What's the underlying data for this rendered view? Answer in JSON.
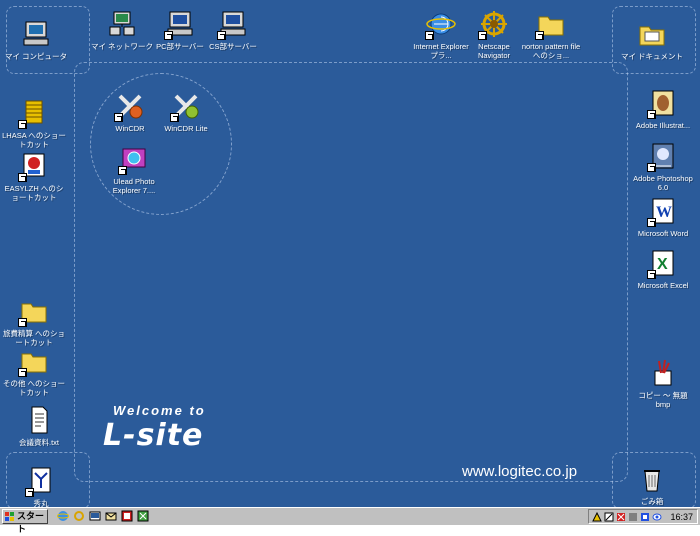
{
  "desktop": {
    "background": "#2b5b9a",
    "icons": {
      "my_computer": "マイ コンピュータ",
      "my_network": "マイ ネットワーク",
      "pc_server": "PC部サーバー",
      "cs_server": "CS部サーバー",
      "internet_explorer": "Internet Explorer プラ...",
      "netscape": "Netscape Navigator",
      "norton": "norton pattern file へのショ...",
      "my_documents": "マイ ドキュメント",
      "lhasa": "LHASA へのショートカット",
      "easylzh": "EASYLZH へのショートカット",
      "wincdr": "WinCDR",
      "wincdr_lite": "WinCDR Lite",
      "ulead": "Ulead Photo Explorer 7....",
      "travel_expense": "旅費精算 へのショートカット",
      "other": "その他 へのショートカット",
      "meeting_doc": "会議資料.txt",
      "hidemaru": "秀丸",
      "illustrator": "Adobe Illustrat...",
      "photoshop": "Adobe Photoshop 6.0",
      "word": "Microsoft Word",
      "excel": "Microsoft Excel",
      "copy_bmp": "コピー ～ 無題 bmp",
      "recycle_bin": "ごみ箱"
    },
    "wallpaper": {
      "welcome": "Welcome to",
      "brand": "L-site",
      "url": "www.logitec.co.jp"
    }
  },
  "taskbar": {
    "start_label": "スタート",
    "clock": "16:37"
  }
}
